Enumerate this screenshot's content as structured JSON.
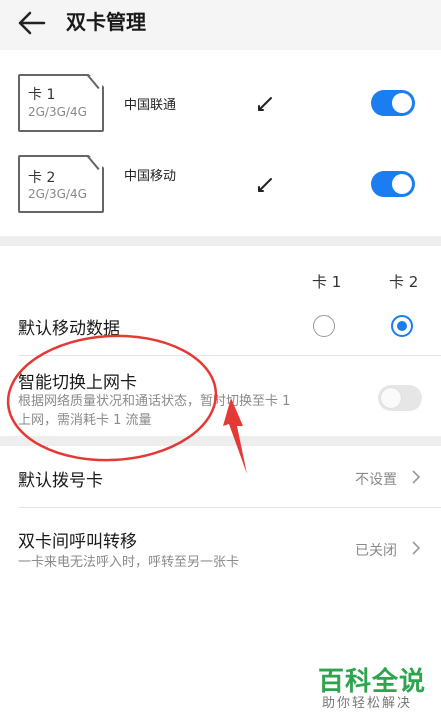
{
  "header": {
    "title": "双卡管理",
    "back_icon": "arrow-left-icon"
  },
  "sims": [
    {
      "name": "卡 1",
      "network": "2G/3G/4G",
      "carrier": "中国联通",
      "enabled": true
    },
    {
      "name": "卡 2",
      "network": "2G/3G/4G",
      "carrier": "中国移动",
      "enabled": true
    }
  ],
  "columns": {
    "card1": "卡 1",
    "card2": "卡 2"
  },
  "default_data": {
    "label": "默认移动数据",
    "selected": "卡 2"
  },
  "smart_switch": {
    "label": "智能切换上网卡",
    "description_line1": "根据网络质量状况和通话状态，暂时切换至卡 1",
    "description_line2": "上网，需消耗卡 1 流量",
    "enabled": false
  },
  "default_dial": {
    "label": "默认拨号卡",
    "value": "不设置"
  },
  "call_forward": {
    "label": "双卡间呼叫转移",
    "description": "一卡来电无法呼入时，呼转至另一张卡",
    "value": "已关闭"
  },
  "colors": {
    "accent": "#1a7df0",
    "annotation": "#e53935",
    "watermark": "#2ea44f"
  },
  "watermark": {
    "title": "百科全说",
    "subtitle": "助你轻松解决"
  }
}
